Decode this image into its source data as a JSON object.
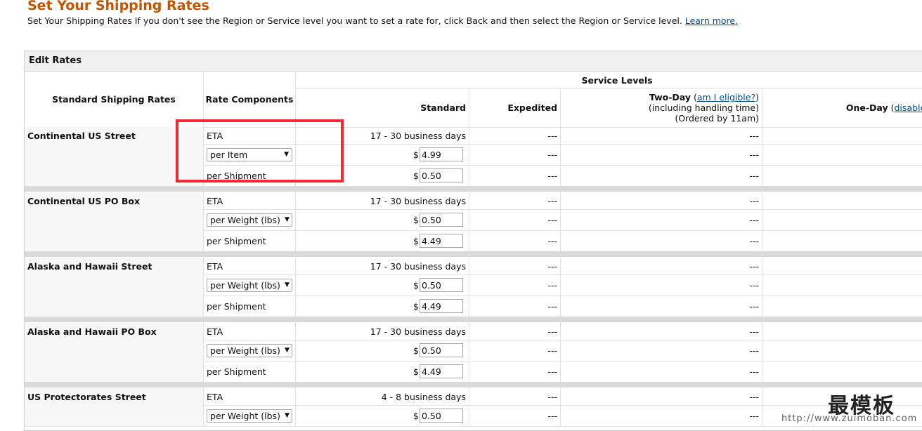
{
  "page": {
    "title": "Set Your Shipping Rates",
    "subtitle": "Set Your Shipping Rates If you don't see the Region or Service level you want to set a rate for, click Back and then select the Region or Service level.",
    "learn_more": "Learn more."
  },
  "panel": {
    "title": "Edit Rates",
    "headers": {
      "standard_shipping_rates": "Standard Shipping Rates",
      "rate_components": "Rate Components",
      "service_levels": "Service Levels",
      "standard": "Standard",
      "expedited": "Expedited",
      "two_day": "Two-Day",
      "two_day_link": "am I eligible?",
      "two_day_note1": "(including handling time)",
      "two_day_note2": "(Ordered by 11am)",
      "one_day": "One-Day",
      "one_day_link": "disabled"
    }
  },
  "common": {
    "eta": "ETA",
    "per_shipment": "per Shipment",
    "dash": "---",
    "dollar": "$",
    "paren_open": "(",
    "paren_close": ")"
  },
  "regions": [
    {
      "name": "Continental US Street",
      "eta": "17 - 30 business days",
      "rate_type": "per Item",
      "rate_value": "4.99",
      "shipment_value": "0.50"
    },
    {
      "name": "Continental US PO Box",
      "eta": "17 - 30 business days",
      "rate_type": "per Weight (lbs)",
      "rate_value": "0.50",
      "shipment_value": "4.49"
    },
    {
      "name": "Alaska and Hawaii Street",
      "eta": "17 - 30 business days",
      "rate_type": "per Weight (lbs)",
      "rate_value": "0.50",
      "shipment_value": "4.49"
    },
    {
      "name": "Alaska and Hawaii PO Box",
      "eta": "17 - 30 business days",
      "rate_type": "per Weight (lbs)",
      "rate_value": "0.50",
      "shipment_value": "4.49"
    },
    {
      "name": "US Protectorates Street",
      "eta": "4 - 8 business days",
      "rate_type": "per Weight (lbs)",
      "rate_value": "0.50",
      "shipment_value": ""
    }
  ],
  "watermark": {
    "logo": "最模板",
    "url": "http://www.zuimoban.com"
  },
  "colors": {
    "title": "#c45500",
    "link": "#004b91",
    "highlight_box": "#f02b35"
  }
}
